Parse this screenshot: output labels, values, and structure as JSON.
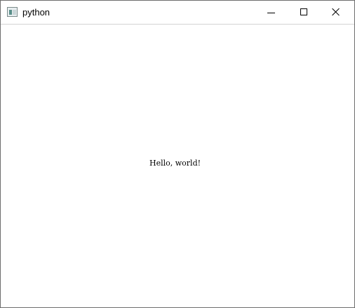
{
  "window": {
    "title": "python",
    "icon": "python-app-icon"
  },
  "titlebar_controls": {
    "minimize_icon": "minimize-icon",
    "maximize_icon": "maximize-icon",
    "close_icon": "close-icon"
  },
  "content": {
    "label_text": "Hello, world!"
  }
}
